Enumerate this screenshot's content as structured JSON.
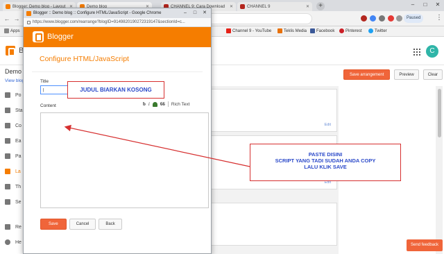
{
  "browser": {
    "tabs": [
      {
        "title": "Blogger: Demo blog - Layout",
        "color": "#f57d00"
      },
      {
        "title": "Demo blog",
        "color": "#f57d00"
      },
      {
        "title": "CHANNEL 9: Cara Download",
        "color": "#b3261e"
      },
      {
        "title": "CHANNEL 9",
        "color": "#b3261e"
      }
    ],
    "paused_label": "Paused"
  },
  "bookmarks": {
    "apps_label": "Apps",
    "items": [
      {
        "label": "Channel 9 - YouTube",
        "color": "#e62117"
      },
      {
        "label": "Teklis Media",
        "color": "#e8710a"
      },
      {
        "label": "Facebook",
        "color": "#3b5998"
      },
      {
        "label": "Pinterest",
        "color": "#cb2027"
      },
      {
        "label": "Twitter",
        "color": "#1da1f2"
      }
    ]
  },
  "blogger_page": {
    "brand": "Bl",
    "blog_name": "Demo blo",
    "view_blog": "View blog",
    "avatar_letter": "C",
    "sidebar": [
      {
        "label": "Po",
        "active": false
      },
      {
        "label": "Sta",
        "active": false
      },
      {
        "label": "Co",
        "active": false
      },
      {
        "label": "Ea",
        "active": false
      },
      {
        "label": "Pa",
        "active": false
      },
      {
        "label": "La",
        "active": true
      },
      {
        "label": "Th",
        "active": false
      },
      {
        "label": "Se",
        "active": false
      },
      {
        "label": "Re",
        "active": false
      },
      {
        "label": "He",
        "active": false
      }
    ],
    "save_arrangement": "Save arrangement",
    "preview": "Preview",
    "clear": "Clear",
    "edit_label": "Edit",
    "send_feedback": "Send feedback"
  },
  "popup": {
    "window_title": "Blogger :: Demo blog :: Configure HTML/JavaScript - Google Chrome",
    "url": "https://www.blogger.com/rearrange?blogID=914982019027231914​7&sectionId=c...",
    "brand": "Blogger",
    "heading": "Configure HTML/JavaScript",
    "title_label": "Title",
    "title_value": "|",
    "content_label": "Content",
    "toolbar": {
      "bold": "b",
      "italic": "i",
      "quote": "66",
      "rich_text": "Rich Text"
    },
    "content_value": "",
    "buttons": {
      "save": "Save",
      "cancel": "Cancel",
      "back": "Back"
    }
  },
  "annotations": {
    "title_note": "JUDUL BIARKAN KOSONG",
    "paste_note_lines": [
      "PASTE DISINI",
      "SCRIPT YANG TADI SUDAH ANDA COPY",
      "LALU KLIK SAVE"
    ],
    "color": "#d62f2f"
  }
}
